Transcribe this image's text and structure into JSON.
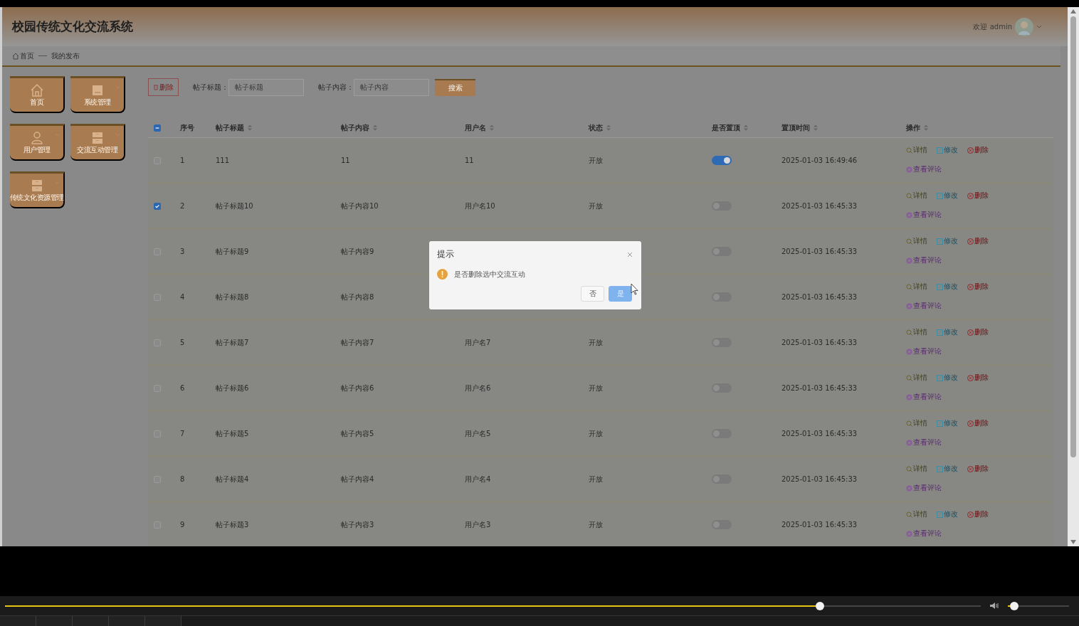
{
  "header": {
    "title": "校园传统文化交流系统",
    "welcome": "欢迎 admin"
  },
  "breadcrumb": [
    {
      "label": "首页",
      "kind": "home"
    },
    {
      "label": "我的发布",
      "kind": "page"
    }
  ],
  "sidebar": {
    "items": [
      {
        "label": "首页",
        "kind": "home",
        "expandable": false
      },
      {
        "label": "系统管理",
        "kind": "box",
        "expandable": true
      },
      {
        "label": "用户管理",
        "kind": "user",
        "expandable": true
      },
      {
        "label": "交流互动管理",
        "kind": "drawer",
        "expandable": true
      },
      {
        "label": "传统文化资源管理",
        "kind": "drawer",
        "expandable": true
      }
    ]
  },
  "toolbar": {
    "delete_button": "删除",
    "filters": [
      {
        "label": "帖子标题：",
        "placeholder": "帖子标题"
      },
      {
        "label": "帖子内容：",
        "placeholder": "帖子内容"
      }
    ],
    "search_button": "搜索"
  },
  "table": {
    "select_all": {
      "indeterminate": true
    },
    "columns": [
      {
        "label": "序号",
        "sortable": false
      },
      {
        "label": "帖子标题",
        "sortable": true
      },
      {
        "label": "帖子内容",
        "sortable": true
      },
      {
        "label": "用户名",
        "sortable": true
      },
      {
        "label": "状态",
        "sortable": true
      },
      {
        "label": "是否置顶",
        "sortable": true
      },
      {
        "label": "置顶时间",
        "sortable": true
      },
      {
        "label": "操作",
        "sortable": true
      }
    ],
    "rows": [
      {
        "checked": false,
        "index": "1",
        "title": "111",
        "content": "11",
        "username": "11",
        "status": "开放",
        "pinned": true,
        "pinned_time": "2025-01-03 16:49:46",
        "actions": [
          "详情",
          "修改",
          "删除",
          "查看评论"
        ]
      },
      {
        "checked": true,
        "index": "2",
        "title": "帖子标题10",
        "content": "帖子内容10",
        "username": "用户名10",
        "status": "开放",
        "pinned": false,
        "pinned_time": "2025-01-03 16:45:33",
        "actions": [
          "详情",
          "修改",
          "删除",
          "查看评论"
        ]
      },
      {
        "checked": false,
        "index": "3",
        "title": "帖子标题9",
        "content": "帖子内容9",
        "pinned": false,
        "pinned_time": "2025-01-03 16:45:33",
        "actions": [
          "详情",
          "修改",
          "删除",
          "查看评论"
        ]
      },
      {
        "checked": false,
        "index": "4",
        "title": "帖子标题8",
        "content": "帖子内容8",
        "pinned": false,
        "pinned_time": "2025-01-03 16:45:33",
        "actions": [
          "详情",
          "修改",
          "删除",
          "查看评论"
        ]
      },
      {
        "checked": false,
        "index": "5",
        "title": "帖子标题7",
        "content": "帖子内容7",
        "username": "用户名7",
        "status": "开放",
        "pinned": false,
        "pinned_time": "2025-01-03 16:45:33",
        "actions": [
          "详情",
          "修改",
          "删除",
          "查看评论"
        ]
      },
      {
        "checked": false,
        "index": "6",
        "title": "帖子标题6",
        "content": "帖子内容6",
        "username": "用户名6",
        "status": "开放",
        "pinned": false,
        "pinned_time": "2025-01-03 16:45:33",
        "actions": [
          "详情",
          "修改",
          "删除",
          "查看评论"
        ]
      },
      {
        "checked": false,
        "index": "7",
        "title": "帖子标题5",
        "content": "帖子内容5",
        "username": "用户名5",
        "status": "开放",
        "pinned": false,
        "pinned_time": "2025-01-03 16:45:33",
        "actions": [
          "详情",
          "修改",
          "删除",
          "查看评论"
        ]
      },
      {
        "checked": false,
        "index": "8",
        "title": "帖子标题4",
        "content": "帖子内容4",
        "username": "用户名4",
        "status": "开放",
        "pinned": false,
        "pinned_time": "2025-01-03 16:45:33",
        "actions": [
          "详情",
          "修改",
          "删除",
          "查看评论"
        ]
      },
      {
        "checked": false,
        "index": "9",
        "title": "帖子标题3",
        "content": "帖子内容3",
        "username": "用户名3",
        "status": "开放",
        "pinned": false,
        "pinned_time": "2025-01-03 16:45:33",
        "actions": [
          "详情",
          "修改",
          "删除",
          "查看评论"
        ]
      }
    ]
  },
  "dialog": {
    "title": "提示",
    "message": "是否删除选中交流互动",
    "buttons": [
      {
        "label": "否",
        "kind": "default"
      },
      {
        "label": "是",
        "kind": "primary"
      }
    ]
  },
  "player": {
    "progress": {
      "level": 0.835
    },
    "volume": {
      "level": 0.1
    }
  }
}
